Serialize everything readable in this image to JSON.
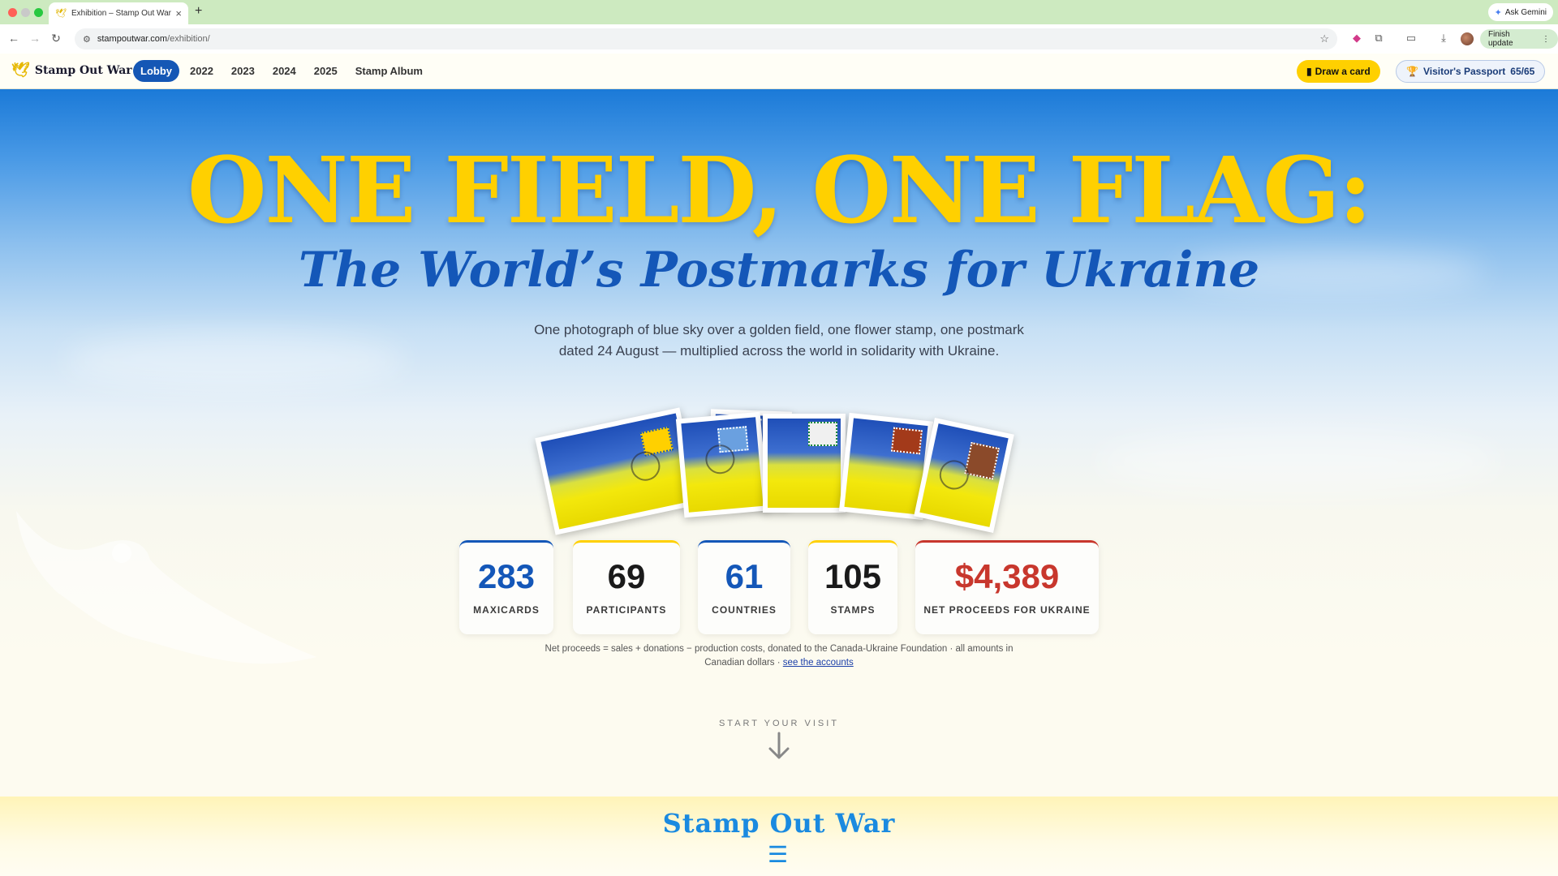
{
  "browser": {
    "tab_title": "Exhibition – Stamp Out War",
    "new_tab_label": "+",
    "close_tab_label": "×",
    "ask_gemini_label": "Ask Gemini",
    "url_host": "stampoutwar.com",
    "url_path": "/exhibition/",
    "finish_update_label": "Finish update",
    "icons": [
      "back-icon",
      "forward-icon",
      "reload-icon",
      "site-info-icon",
      "bookmark-star-icon",
      "extension-icon",
      "puzzle-icon",
      "cast-icon",
      "download-icon",
      "profile-avatar",
      "more-icon"
    ]
  },
  "site": {
    "brand": "Stamp Out War",
    "nav": [
      {
        "label": "Lobby",
        "active": true
      },
      {
        "label": "2022",
        "active": false
      },
      {
        "label": "2023",
        "active": false
      },
      {
        "label": "2024",
        "active": false
      },
      {
        "label": "2025",
        "active": false
      },
      {
        "label": "Stamp Album",
        "active": false
      }
    ],
    "draw_card_label": "Draw a card",
    "passport_label": "Visitor's Passport",
    "passport_count": "65/65"
  },
  "hero": {
    "title": "ONE FIELD, ONE FLAG:",
    "subtitle": "The World’s Postmarks for Ukraine",
    "description": "One photograph of blue sky over a golden field, one flower stamp, one postmark dated 24 August — multiplied across the world in solidarity with Ukraine.",
    "stats": [
      {
        "value": "283",
        "label": "MAXICARDS",
        "color": "#1457b8"
      },
      {
        "value": "69",
        "label": "PARTICIPANTS",
        "color": "#1a1a1a"
      },
      {
        "value": "61",
        "label": "COUNTRIES",
        "color": "#1457b8"
      },
      {
        "value": "105",
        "label": "STAMPS",
        "color": "#1a1a1a"
      },
      {
        "value": "$4,389",
        "label": "NET PROCEEDS FOR UKRAINE",
        "color": "#c8372d"
      }
    ],
    "note_text": "Net proceeds = sales + donations − production costs, donated to the Canada-Ukraine Foundation · all amounts in Canadian dollars ·",
    "note_link": "see the accounts",
    "start_visit": "START YOUR VISIT"
  },
  "footer_band": {
    "title": "Stamp Out War",
    "menu_icon": "☰"
  },
  "colors": {
    "flag_blue": "#1457b8",
    "flag_yellow": "#ffd000",
    "accent_red": "#c8372d"
  }
}
